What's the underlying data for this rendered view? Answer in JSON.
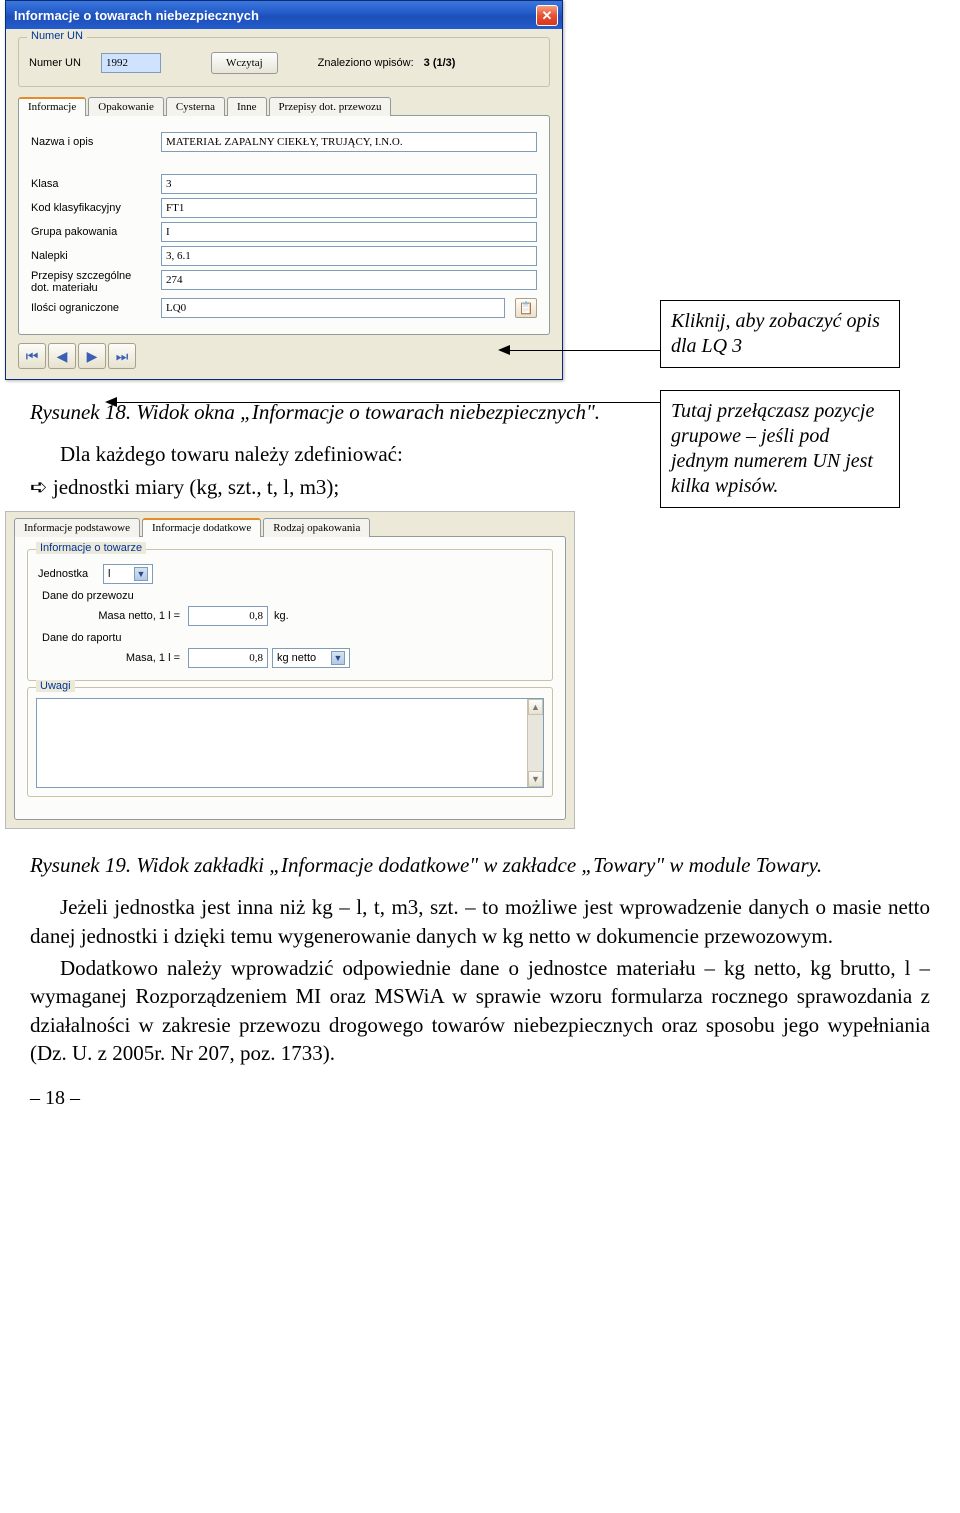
{
  "window1": {
    "title": "Informacje o towarach niebezpiecznych",
    "group_un": {
      "legend": "Numer UN",
      "numer_label": "Numer UN",
      "numer_value": "1992",
      "wczytaj": "Wczytaj",
      "found_label": "Znaleziono wpisów:",
      "found_value": "3 (1/3)"
    },
    "tabs": [
      "Informacje",
      "Opakowanie",
      "Cysterna",
      "Inne",
      "Przepisy dot. przewozu"
    ],
    "fields": {
      "nazwa_label": "Nazwa i opis",
      "nazwa_value": "MATERIAŁ ZAPALNY CIEKŁY, TRUJĄCY, I.N.O.",
      "klasa_label": "Klasa",
      "klasa_value": "3",
      "kod_label": "Kod klasyfikacyjny",
      "kod_value": "FT1",
      "grupa_label": "Grupa pakowania",
      "grupa_value": "I",
      "nalepki_label": "Nalepki",
      "nalepki_value": "3, 6.1",
      "przepisy_label1": "Przepisy szczególne",
      "przepisy_label2": "dot. materiału",
      "przepisy_value": "274",
      "ilosci_label": "Ilości ograniczone",
      "ilosci_value": "LQ0"
    }
  },
  "callout1": "Kliknij, aby zobaczyć opis dla LQ 3",
  "callout2": "Tutaj przełączasz pozycje grupowe – jeśli pod jednym numerem UN jest kilka wpisów.",
  "caption18": "Rysunek 18. Widok okna „Informacje o towarach niebezpiecznych\".",
  "para_def1": "Dla każdego towaru należy zdefiniować:",
  "para_def2": "jednostki miary (kg, szt., t, l, m3);",
  "panel2": {
    "tabs": [
      "Informacje podstawowe",
      "Informacje dodatkowe",
      "Rodzaj opakowania"
    ],
    "group1_legend": "Informacje o towarze",
    "jednostka_label": "Jednostka",
    "jednostka_value": "l",
    "dane_przewozu": "Dane do przewozu",
    "masa_netto_label": "Masa netto, 1 l =",
    "masa_netto_value": "0,8",
    "masa_netto_unit": "kg.",
    "dane_raportu": "Dane do raportu",
    "masa_label": "Masa, 1 l =",
    "masa_value": "0,8",
    "masa_unit": "kg netto",
    "uwagi_legend": "Uwagi"
  },
  "caption19": "Rysunek 19. Widok zakładki „Informacje dodatkowe\" w zakładce „Towary\" w module Towary.",
  "body_para1": "Jeżeli jednostka jest inna niż kg – l, t, m3, szt. – to możliwe jest wprowadzenie danych o masie netto danej jednostki i dzięki temu wygenerowanie danych w kg netto w dokumencie przewozowym.",
  "body_para2": "Dodatkowo należy wprowadzić odpowiednie dane o jednostce materiału – kg netto, kg brutto, l – wymaganej Rozporządzeniem MI oraz MSWiA w sprawie wzoru formularza rocznego sprawozdania z działalności w zakresie przewozu drogowego towarów niebezpiecznych oraz sposobu jego wypełniania (Dz. U. z 2005r. Nr 207, poz. 1733).",
  "page_number": "– 18 –"
}
